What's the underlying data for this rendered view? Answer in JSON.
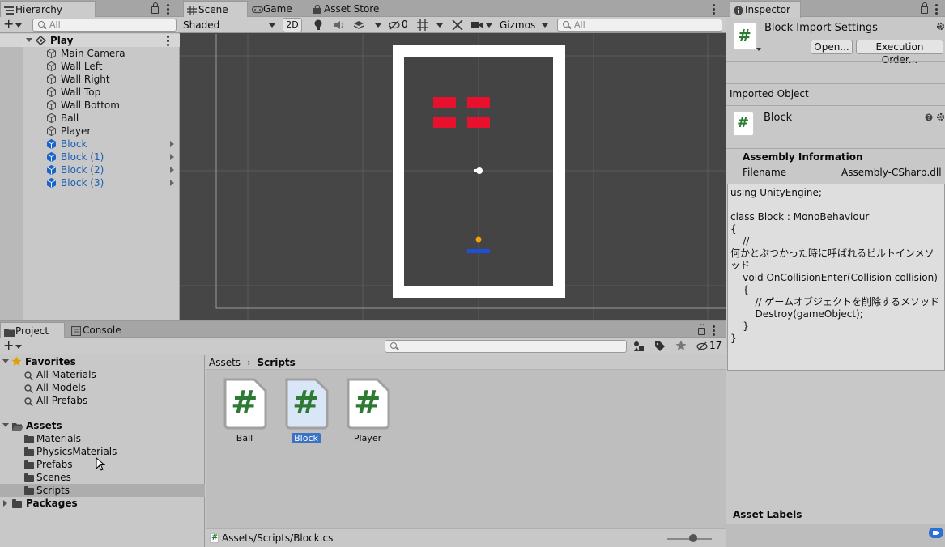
{
  "hierarchy": {
    "tab": "Hierarchy",
    "search_placeholder": "All",
    "scene": "Play",
    "items": [
      {
        "label": "Main Camera",
        "selected": false
      },
      {
        "label": "Wall Left",
        "selected": false
      },
      {
        "label": "Wall Right",
        "selected": false
      },
      {
        "label": "Wall Top",
        "selected": false
      },
      {
        "label": "Wall Bottom",
        "selected": false
      },
      {
        "label": "Ball",
        "selected": false
      },
      {
        "label": "Player",
        "selected": false
      },
      {
        "label": "Block",
        "selected": true
      },
      {
        "label": "Block (1)",
        "selected": true
      },
      {
        "label": "Block (2)",
        "selected": true
      },
      {
        "label": "Block (3)",
        "selected": true
      }
    ]
  },
  "scene_view": {
    "tabs": [
      "Scene",
      "Game",
      "Asset Store"
    ],
    "shading": "Shaded",
    "mode_2d": "2D",
    "hidden_count": "0",
    "gizmos": "Gizmos",
    "search_placeholder": "All"
  },
  "project": {
    "tabs": [
      "Project",
      "Console"
    ],
    "badge_count": "17",
    "favorites_label": "Favorites",
    "favorites": [
      "All Materials",
      "All Models",
      "All Prefabs"
    ],
    "assets_label": "Assets",
    "folders": [
      "Materials",
      "PhysicsMaterials",
      "Prefabs",
      "Scenes",
      "Scripts"
    ],
    "packages_label": "Packages",
    "breadcrumb": [
      "Assets",
      "Scripts"
    ],
    "files": [
      {
        "name": "Ball",
        "selected": false
      },
      {
        "name": "Block",
        "selected": true
      },
      {
        "name": "Player",
        "selected": false
      }
    ],
    "path": "Assets/Scripts/Block.cs"
  },
  "inspector": {
    "tab": "Inspector",
    "title": "Block Import Settings",
    "open_btn": "Open...",
    "exec_btn": "Execution Order...",
    "imported_object": "Imported Object",
    "object_name": "Block",
    "assembly_header": "Assembly Information",
    "filename_label": "Filename",
    "filename_value": "Assembly-CSharp.dll",
    "code": "using UnityEngine;\n\nclass Block : MonoBehaviour\n{\n    //\n何かとぶつかった時に呼ばれるビルトインメソッド\n    void OnCollisionEnter(Collision collision)\n    {\n        // ゲームオブジェクトを削除するメソッド\n        Destroy(gameObject);\n    }\n}",
    "asset_labels": "Asset Labels"
  }
}
